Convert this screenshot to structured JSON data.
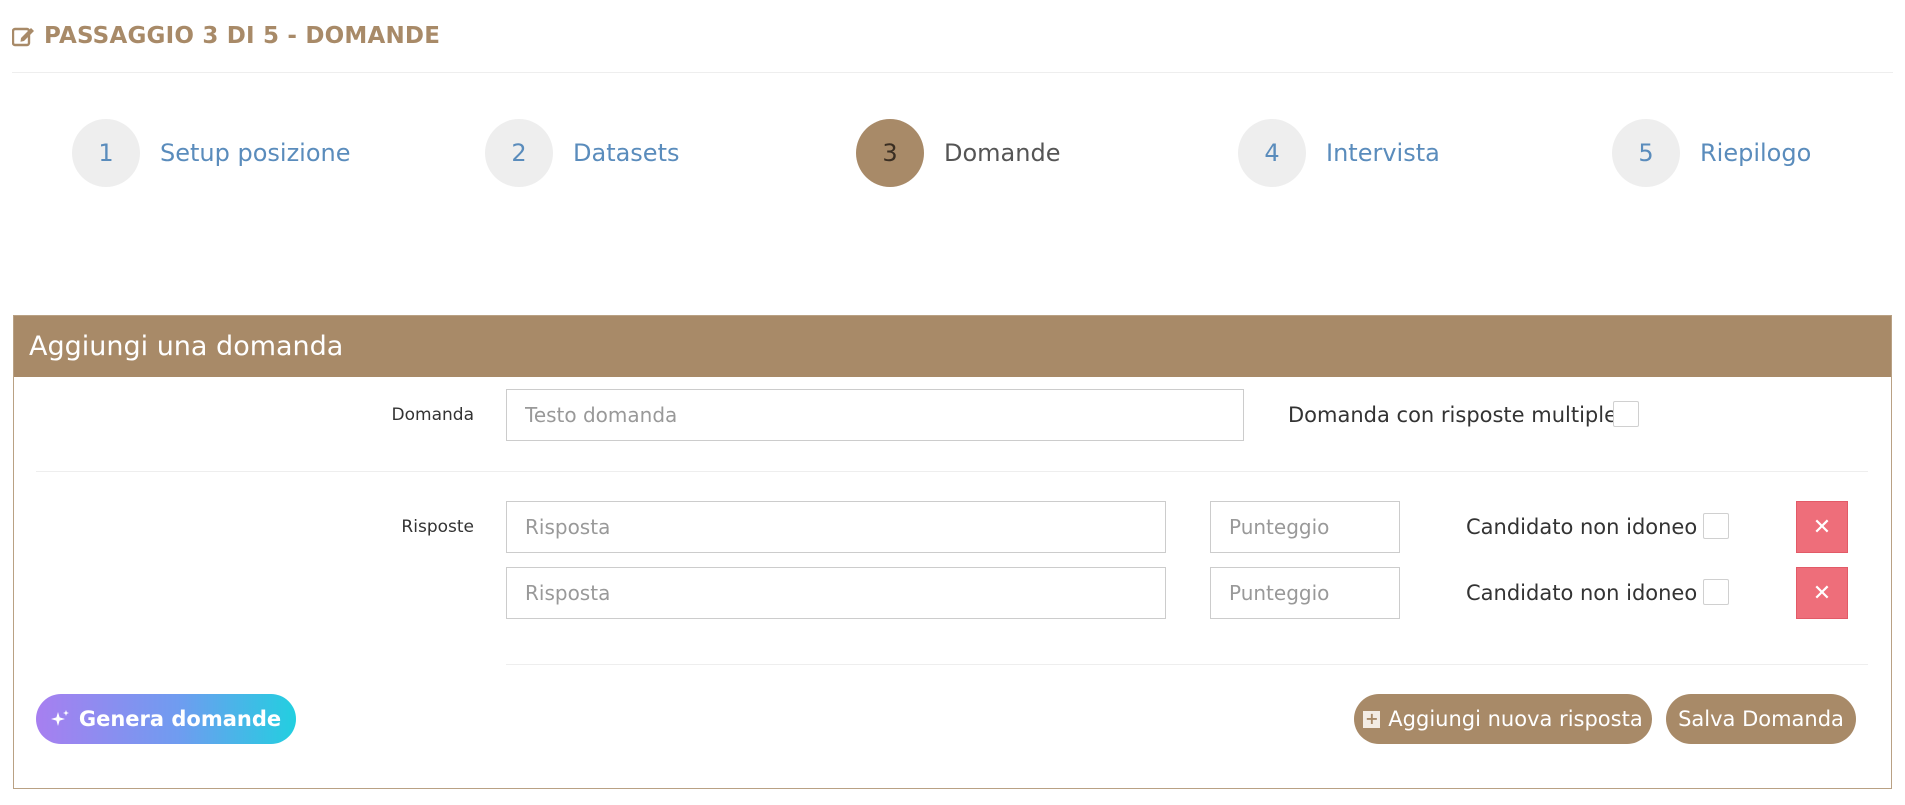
{
  "header": {
    "title": "PASSAGGIO 3 DI 5 - DOMANDE"
  },
  "steps": [
    {
      "number": "1",
      "label": "Setup posizione"
    },
    {
      "number": "2",
      "label": "Datasets"
    },
    {
      "number": "3",
      "label": "Domande"
    },
    {
      "number": "4",
      "label": "Intervista"
    },
    {
      "number": "5",
      "label": "Riepilogo"
    }
  ],
  "panel": {
    "title": "Aggiungi una domanda",
    "question_label": "Domanda",
    "question_placeholder": "Testo domanda",
    "multiple_label": "Domanda con risposte multiple",
    "answers_label": "Risposte",
    "answers": [
      {
        "answer_placeholder": "Risposta",
        "score_placeholder": "Punteggio",
        "unfit_label": "Candidato non idoneo"
      },
      {
        "answer_placeholder": "Risposta",
        "score_placeholder": "Punteggio",
        "unfit_label": "Candidato non idoneo"
      }
    ],
    "generate_label": "Genera domande",
    "add_answer_label": "Aggiungi nuova risposta",
    "save_label": "Salva Domanda"
  },
  "colors": {
    "brand": "#a88a68",
    "link": "#5a8cbc",
    "danger": "#ee6e7a"
  }
}
